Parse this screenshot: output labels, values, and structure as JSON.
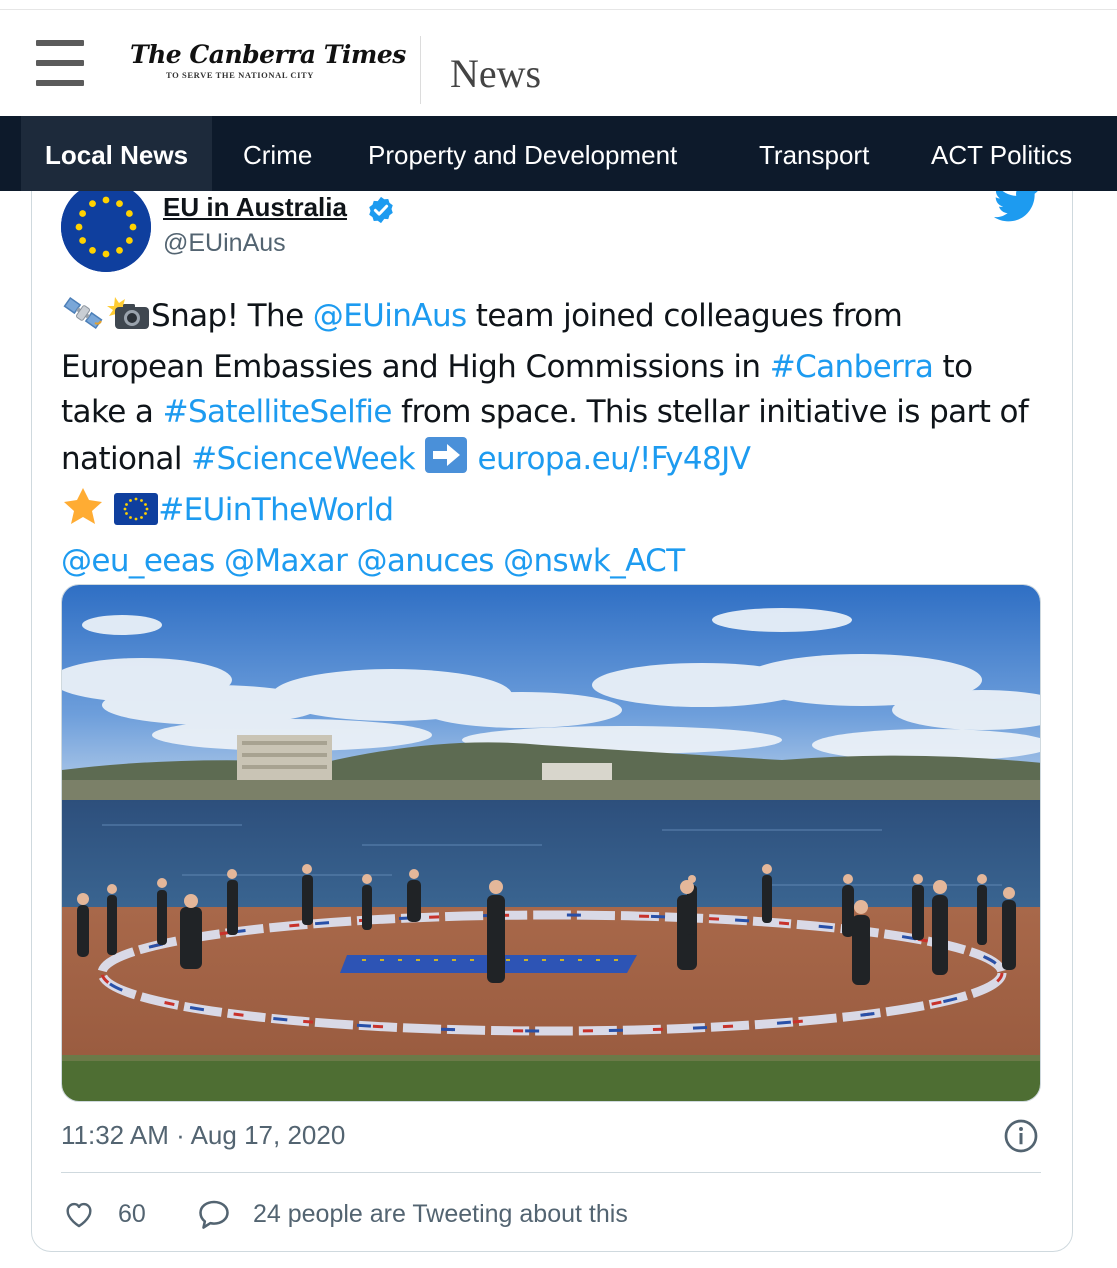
{
  "header": {
    "logo_text": "The Canberra Times",
    "logo_tagline": "TO SERVE THE NATIONAL CITY",
    "section": "News"
  },
  "nav": {
    "items": [
      {
        "label": "Local News",
        "active": true
      },
      {
        "label": "Crime"
      },
      {
        "label": "Property and Development"
      },
      {
        "label": "Transport"
      },
      {
        "label": "ACT Politics"
      }
    ]
  },
  "tweet": {
    "author_name": "EU in Australia",
    "handle": "@EUinAus",
    "text": {
      "t1": "Snap! The ",
      "mention1": "@EUinAus",
      "t2": " team joined colleagues from European Embassies and High Commissions in ",
      "tag_canberra": "#Canberra",
      "t3": " to take a ",
      "tag_selfie": "#SatelliteSelfie",
      "t4": " from space. This stellar initiative is part of national ",
      "tag_science": "#ScienceWeek",
      "link": "europa.eu/!Fy48JV",
      "tag_world": "#EUinTheWorld",
      "m_eeas": "@eu_eeas",
      "m_maxar": "@Maxar",
      "m_anuces": "@anuces",
      "m_nswk": "@nswk_ACT"
    },
    "timestamp": "11:32 AM · Aug 17, 2020",
    "likes": "60",
    "replies_text": "24 people are Tweeting about this"
  },
  "colors": {
    "nav_bg": "#0d1a2b",
    "link_blue": "#1d9bf0",
    "eu_blue": "#0f3f9e",
    "muted": "#536471"
  },
  "icons": [
    "hamburger-icon",
    "verified-badge-icon",
    "twitter-bird-icon",
    "satellite-emoji",
    "camera-flash-emoji",
    "right-arrow-emoji",
    "star-emoji",
    "eu-flag-emoji",
    "info-icon",
    "heart-icon",
    "speech-bubble-icon"
  ]
}
